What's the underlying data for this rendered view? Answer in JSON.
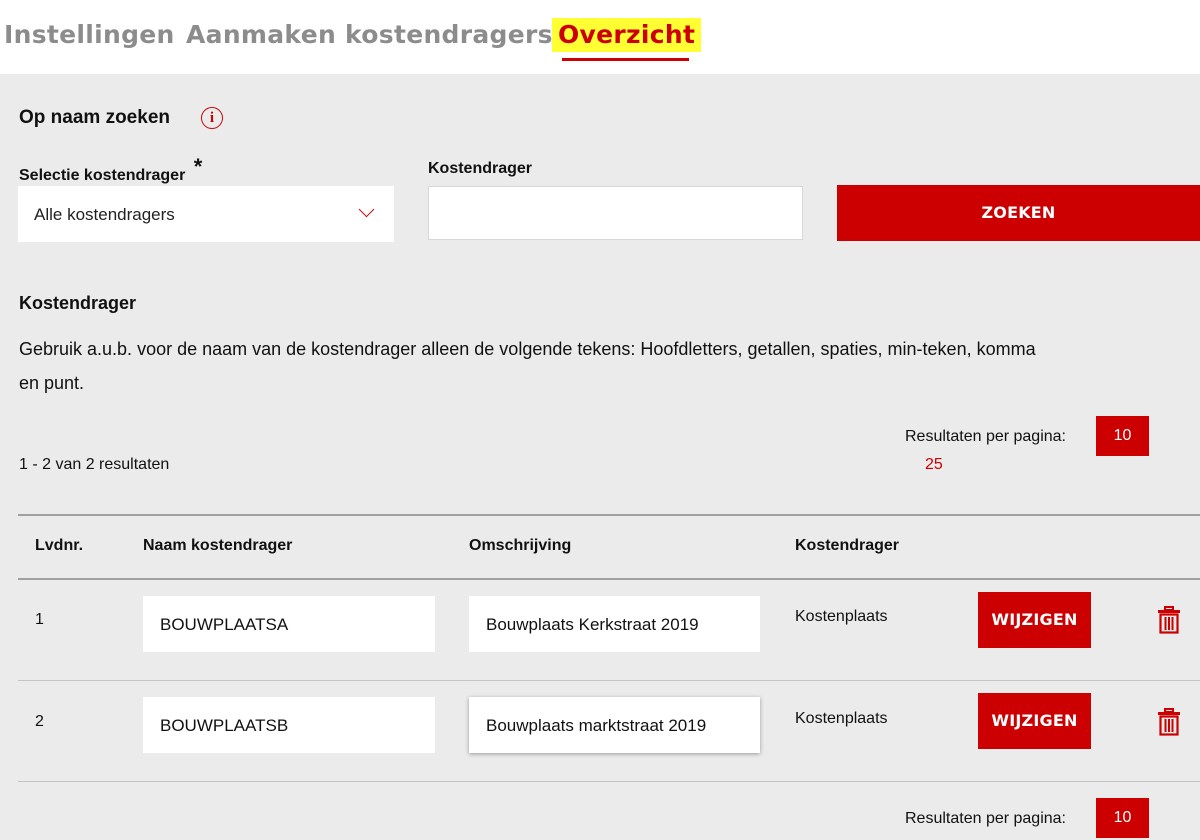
{
  "tabs": [
    {
      "label": "Instellingen"
    },
    {
      "label": "Aanmaken kostendragers"
    },
    {
      "label": "Overzicht"
    }
  ],
  "search": {
    "heading": "Op naam zoeken",
    "select_label": "Selectie kostendrager",
    "required_mark": "*",
    "select_value": "Alle kostendragers",
    "input_label": "Kostendrager",
    "input_value": "",
    "button_label": "ZOEKEN"
  },
  "info": {
    "heading": "Kostendrager",
    "text_line1": "Gebruik a.u.b. voor de naam van de kostendrager alleen de volgende tekens: Hoofdletters, getallen, spaties, min-teken, komma",
    "text_line2": "en punt."
  },
  "results": {
    "summary": "1 - 2 van 2 resultaten",
    "per_page_label": "Resultaten per pagina:",
    "per_page_selected": "10",
    "per_page_option": "25"
  },
  "table": {
    "headers": [
      "Lvdnr.",
      "Naam kostendrager",
      "Omschrijving",
      "Kostendrager"
    ],
    "rows": [
      {
        "nr": "1",
        "naam": "BOUWPLAATSA",
        "omschrijving": "Bouwplaats Kerkstraat 2019",
        "type": "Kostenplaats",
        "action": "WIJZIGEN"
      },
      {
        "nr": "2",
        "naam": "BOUWPLAATSB",
        "omschrijving": "Bouwplaats marktstraat 2019",
        "type": "Kostenplaats",
        "action": "WIJZIGEN"
      }
    ]
  },
  "footer": {
    "per_page_label": "Resultaten per pagina:",
    "per_page_selected": "10"
  },
  "colors": {
    "accent": "#cc0000",
    "panel_bg": "#ebebeb",
    "tab_highlight": "#ffff33",
    "tab_inactive": "#8c8c8c"
  },
  "icons": {
    "info": "info-icon",
    "chevron": "chevron-down-icon",
    "delete": "trash-icon"
  }
}
